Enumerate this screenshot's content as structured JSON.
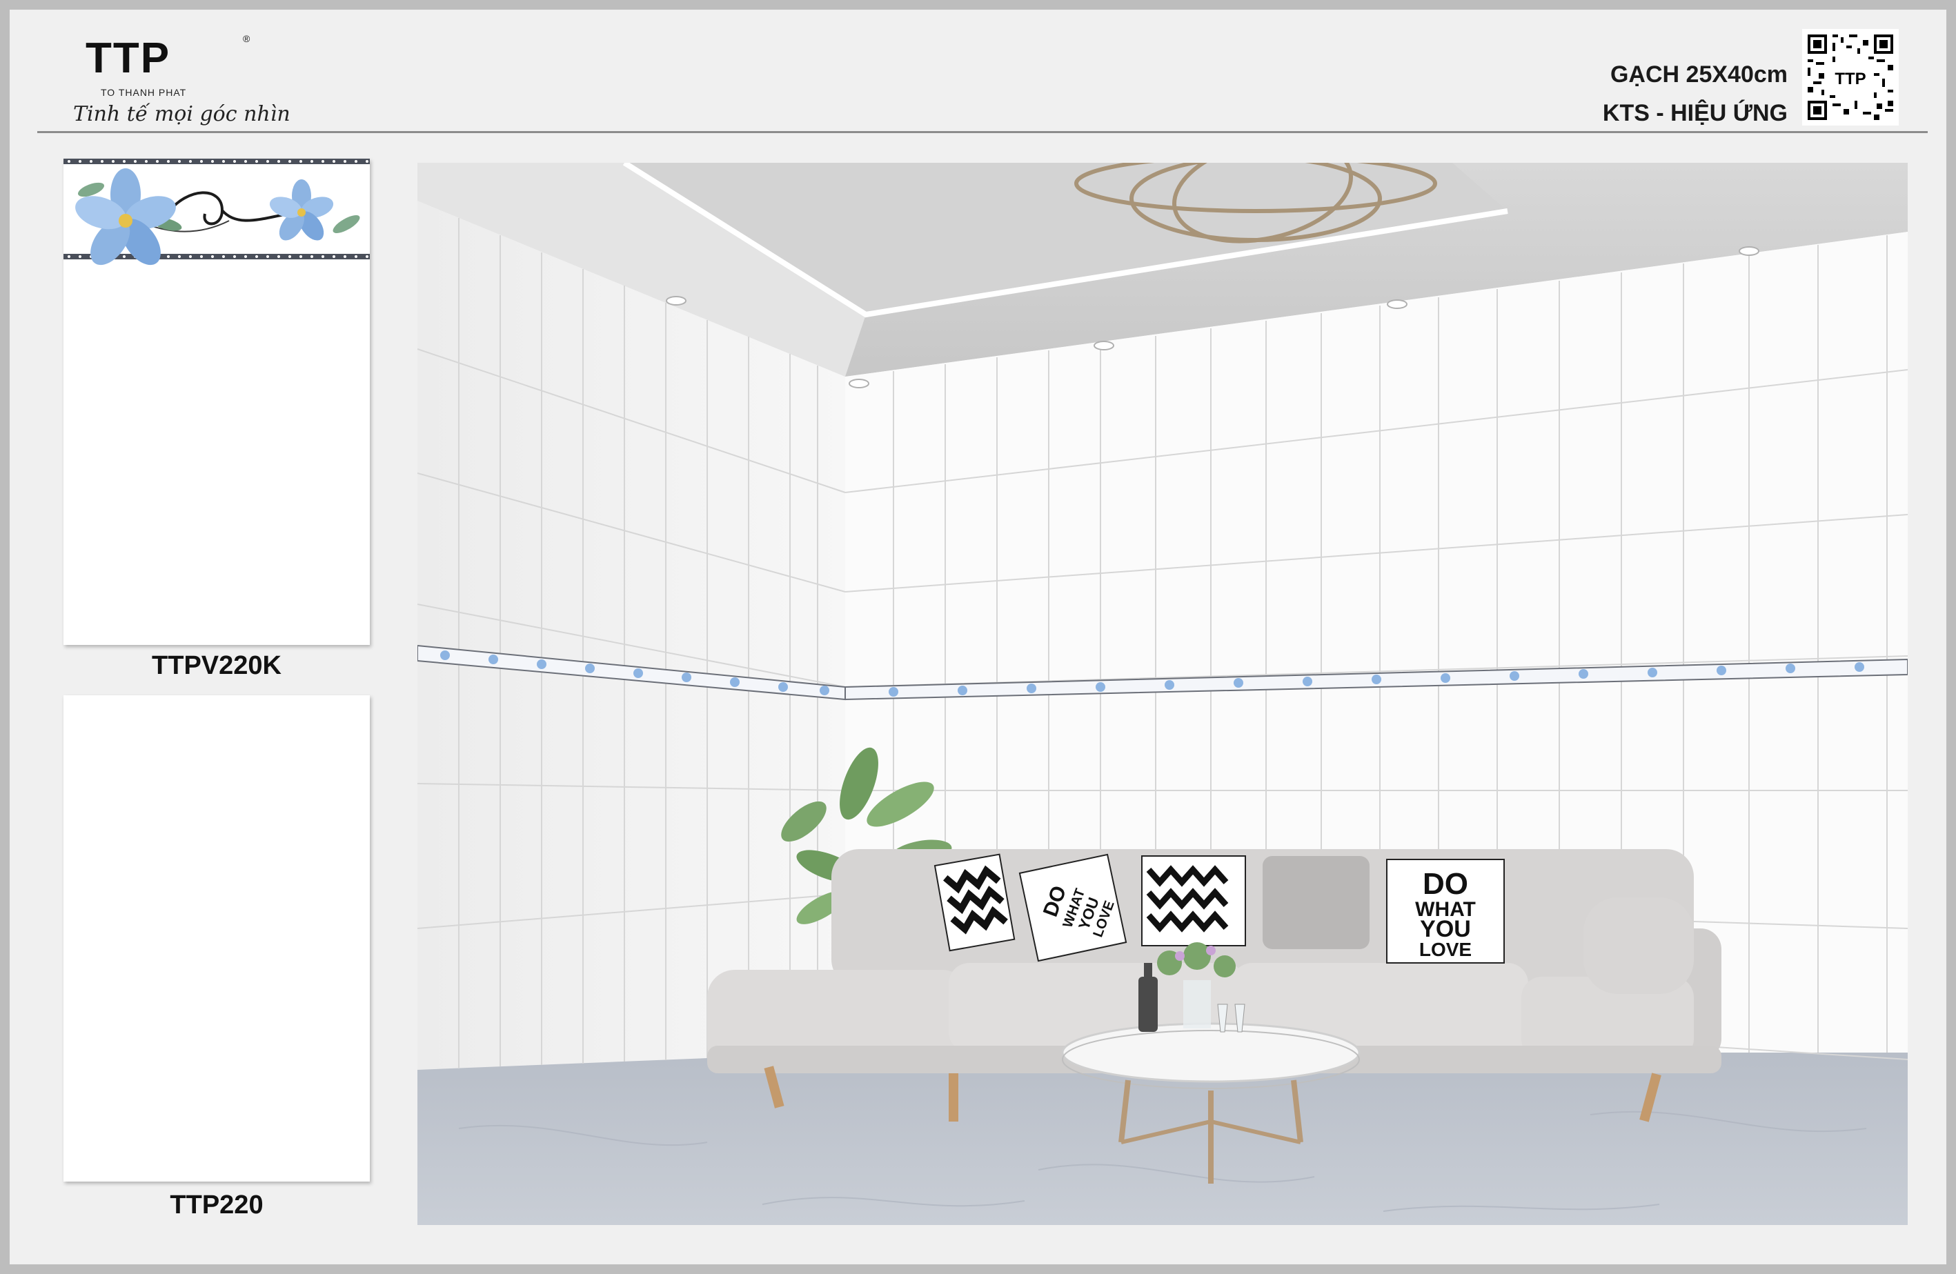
{
  "brand": {
    "mark": "TTP",
    "registered": "®",
    "subtitle": "TO THANH PHAT",
    "tagline": "Tinh tế mọi góc nhìn"
  },
  "spec": {
    "line1": "GẠCH 25X40cm",
    "line2": "KTS - HIỆU ỨNG"
  },
  "qr": {
    "label": "TTP"
  },
  "swatches": [
    {
      "code": "TTPV220K",
      "pattern": "blue-flower-border"
    },
    {
      "code": "TTP220",
      "pattern": "plain-white"
    }
  ],
  "scene": {
    "pillows": [
      {
        "text": ""
      },
      {
        "text": "DO WHAT YOU LOVE"
      },
      {
        "text": ""
      },
      {
        "text": ""
      },
      {
        "text": "DO WHAT YOU LOVE"
      }
    ],
    "pillow_texts": {
      "line1": "DO",
      "line2": "WHAT",
      "line3": "YOU",
      "line4": "LOVE"
    },
    "colors": {
      "tile": "#fbfbfb",
      "grout": "#d6d6d6",
      "floor": "#c3c8d1",
      "sofa": "#dedcdb",
      "flower": "#8db4e2"
    }
  }
}
